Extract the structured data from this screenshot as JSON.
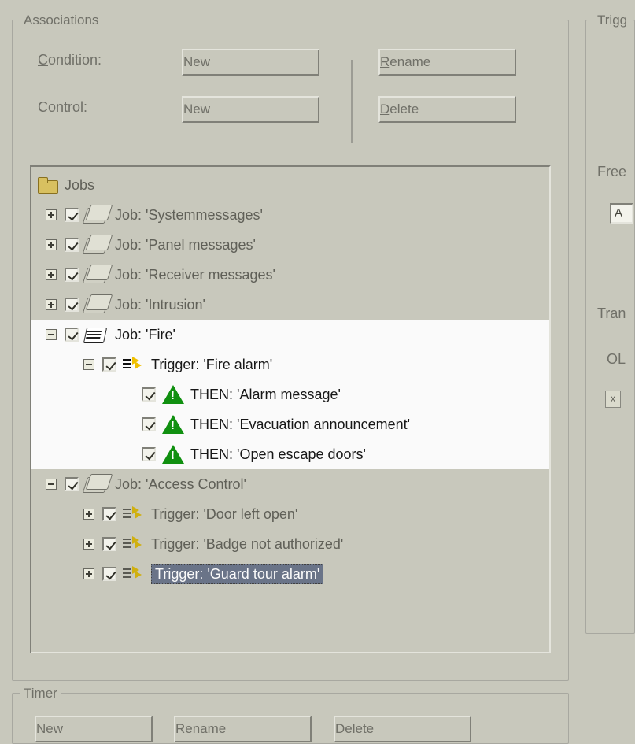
{
  "groups": {
    "associations": "Associations",
    "timer": "Timer",
    "trigg": "Trigg"
  },
  "labels": {
    "condition_pre": "C",
    "condition_post": "ondition:",
    "control_pre": "C",
    "control_post": "ontrol:"
  },
  "buttons": {
    "new": "New",
    "rename_pre": "R",
    "rename_post": "ename",
    "delete_pre": "D",
    "delete_post": "elete"
  },
  "side": {
    "free": "Free",
    "a": "A",
    "trans": "Tran",
    "ol": "OL",
    "x": "x"
  },
  "tree": {
    "root": "Jobs",
    "jobs": [
      {
        "label": "Job: 'Systemmessages'"
      },
      {
        "label": "Job: 'Panel messages'"
      },
      {
        "label": "Job: 'Receiver messages'"
      },
      {
        "label": "Job: 'Intrusion'"
      }
    ],
    "fire": {
      "label": "Job: 'Fire'",
      "trigger": "Trigger: 'Fire alarm'",
      "thens": [
        "THEN: 'Alarm message'",
        "THEN: 'Evacuation announcement'",
        "THEN: 'Open escape doors'"
      ]
    },
    "access": {
      "label": "Job: 'Access Control'",
      "triggers": [
        "Trigger: 'Door left open'",
        "Trigger: 'Badge not authorized'",
        "Trigger: 'Guard tour alarm'"
      ]
    }
  },
  "timerButtons": {
    "new": "New",
    "rename": "Rename",
    "delete": "Delete"
  }
}
